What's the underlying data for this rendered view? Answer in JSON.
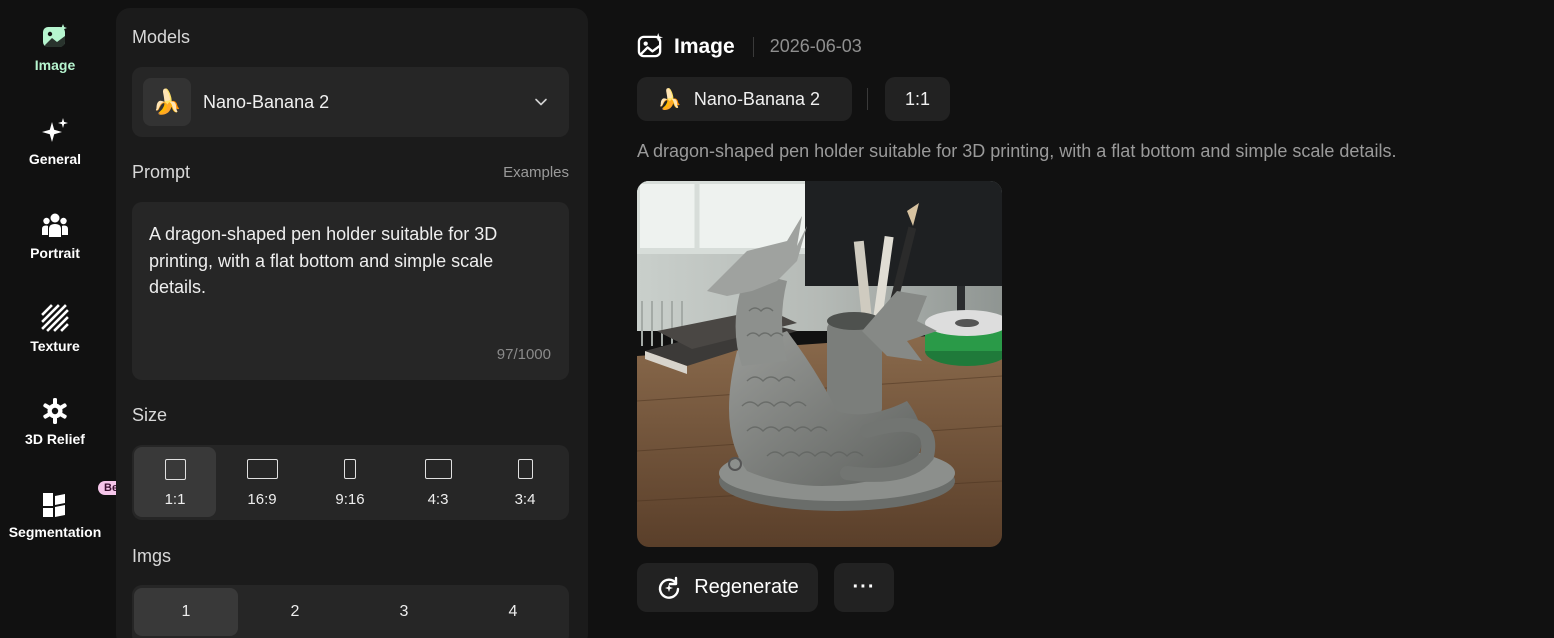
{
  "nav": {
    "items": [
      {
        "label": "Image",
        "icon": "image-sparkle-icon",
        "active": true
      },
      {
        "label": "General",
        "icon": "sparkles-icon"
      },
      {
        "label": "Portrait",
        "icon": "people-icon"
      },
      {
        "label": "Texture",
        "icon": "hatch-texture-icon"
      },
      {
        "label": "3D Relief",
        "icon": "relief-gear-icon"
      },
      {
        "label": "Segmentation",
        "icon": "segmentation-icon",
        "badge": "Beta"
      }
    ]
  },
  "panel": {
    "models_title": "Models",
    "model": {
      "emoji": "🍌",
      "name": "Nano-Banana 2"
    },
    "prompt_title": "Prompt",
    "examples_label": "Examples",
    "prompt_text": "A dragon-shaped pen holder suitable for 3D printing, with a flat bottom and simple scale details.",
    "prompt_counter": "97/1000",
    "size_title": "Size",
    "sizes": [
      "1:1",
      "16:9",
      "9:16",
      "4:3",
      "3:4"
    ],
    "size_selected": "1:1",
    "imgs_title": "Imgs",
    "imgs": [
      "1",
      "2",
      "3",
      "4"
    ],
    "imgs_selected": "1"
  },
  "result": {
    "title": "Image",
    "date": "2026-06-03",
    "model_emoji": "🍌",
    "model_name": "Nano-Banana 2",
    "ratio": "1:1",
    "prompt": "A dragon-shaped pen holder suitable for 3D printing, with a flat bottom and simple scale details.",
    "regenerate_label": "Regenerate",
    "more_label": "···"
  },
  "colors": {
    "background": "#111111",
    "panel": "#1b1b1b",
    "field": "#262626",
    "active_nav": "#b6f5cf",
    "beta_badge": "#f5c6ea"
  }
}
